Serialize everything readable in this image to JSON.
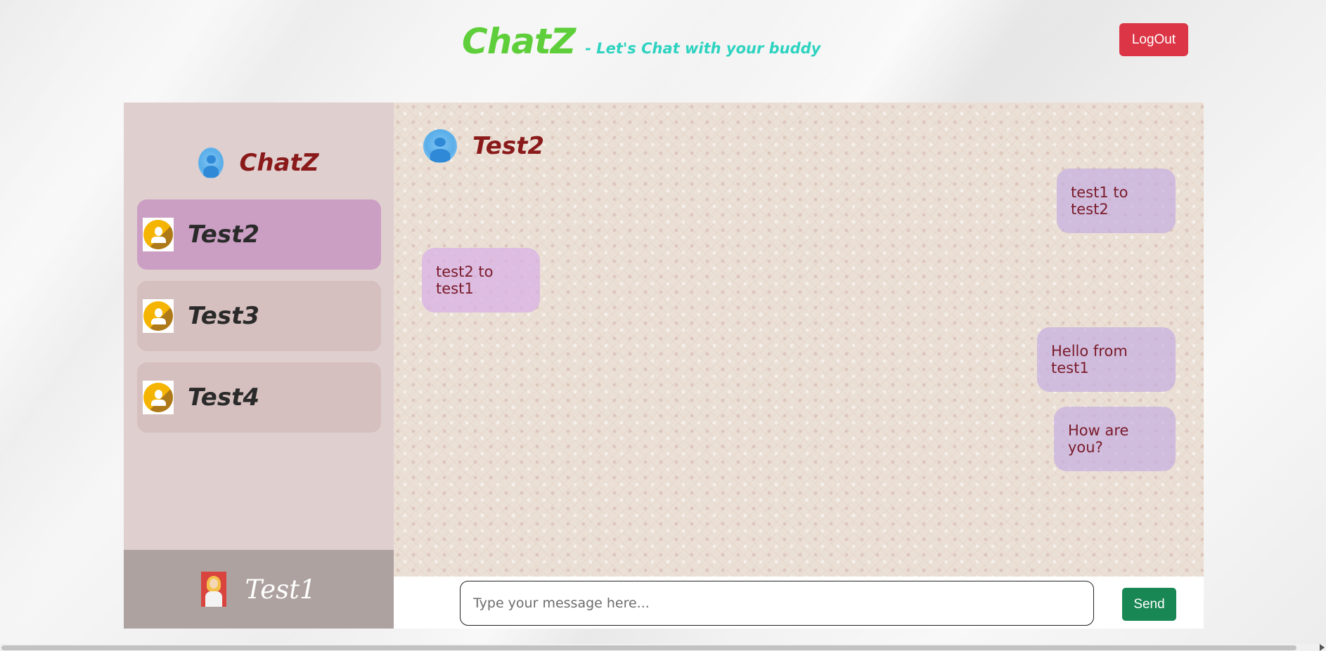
{
  "header": {
    "brand_title": "ChatZ",
    "brand_tagline": "- Let's Chat with your buddy",
    "logout_label": "LogOut"
  },
  "sidebar": {
    "title": "ChatZ",
    "contacts": [
      {
        "name": "Test2",
        "active": true
      },
      {
        "name": "Test3",
        "active": false
      },
      {
        "name": "Test4",
        "active": false
      }
    ],
    "current_user": "Test1"
  },
  "chat": {
    "contact_name": "Test2",
    "messages": [
      {
        "direction": "out",
        "text": "test1 to test2"
      },
      {
        "direction": "in",
        "text": "test2 to test1"
      },
      {
        "direction": "out",
        "text": "Hello from test1"
      },
      {
        "direction": "out",
        "text": "How are you?"
      }
    ],
    "input_placeholder": "Type your message here...",
    "input_value": "",
    "send_label": "Send"
  },
  "colors": {
    "brand": "#5ecf3a",
    "tagline": "#2ed3c0",
    "logout": "#dc3545",
    "send": "#198754",
    "name_accent": "#8a1a1a"
  },
  "icons": {
    "sidebar_logo": "user-avatar-icon",
    "contact_avatar": "contact-avatar-icon",
    "current_user_avatar": "user-profile-icon"
  }
}
